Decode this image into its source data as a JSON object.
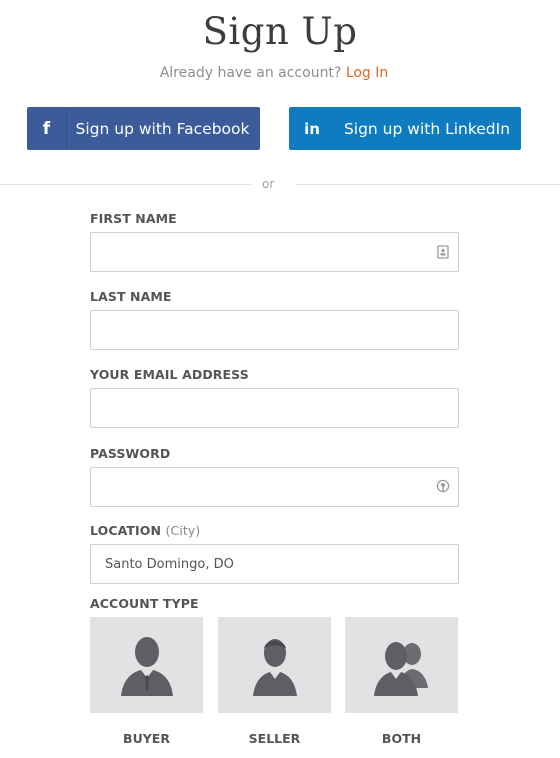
{
  "header": {
    "title": "Sign Up",
    "subtitle": "Already have an account?",
    "login_link": "Log In"
  },
  "social": {
    "facebook": {
      "icon": "facebook-icon",
      "glyph": "f",
      "label": "Sign up with Facebook",
      "color": "#3b5b99"
    },
    "linkedin": {
      "icon": "linkedin-icon",
      "glyph": "in",
      "label": "Sign up with LinkedIn",
      "color": "#0e7cbf"
    }
  },
  "divider_text": "or",
  "form": {
    "first_name": {
      "label": "FIRST NAME",
      "value": ""
    },
    "last_name": {
      "label": "LAST NAME",
      "value": ""
    },
    "email": {
      "label": "YOUR EMAIL ADDRESS",
      "value": ""
    },
    "password": {
      "label": "PASSWORD",
      "value": ""
    },
    "location": {
      "label": "LOCATION",
      "hint": "(City)",
      "value": "Santo Domingo, DO"
    }
  },
  "account_type": {
    "label": "ACCOUNT TYPE",
    "options": [
      {
        "label": "BUYER",
        "icon": "buyer-avatar-icon"
      },
      {
        "label": "SELLER",
        "icon": "seller-avatar-icon"
      },
      {
        "label": "BOTH",
        "icon": "both-avatars-icon"
      }
    ]
  },
  "colors": {
    "link": "#e0662b",
    "tile_bg": "#e2e2e4",
    "avatar": "#5f5f63"
  }
}
